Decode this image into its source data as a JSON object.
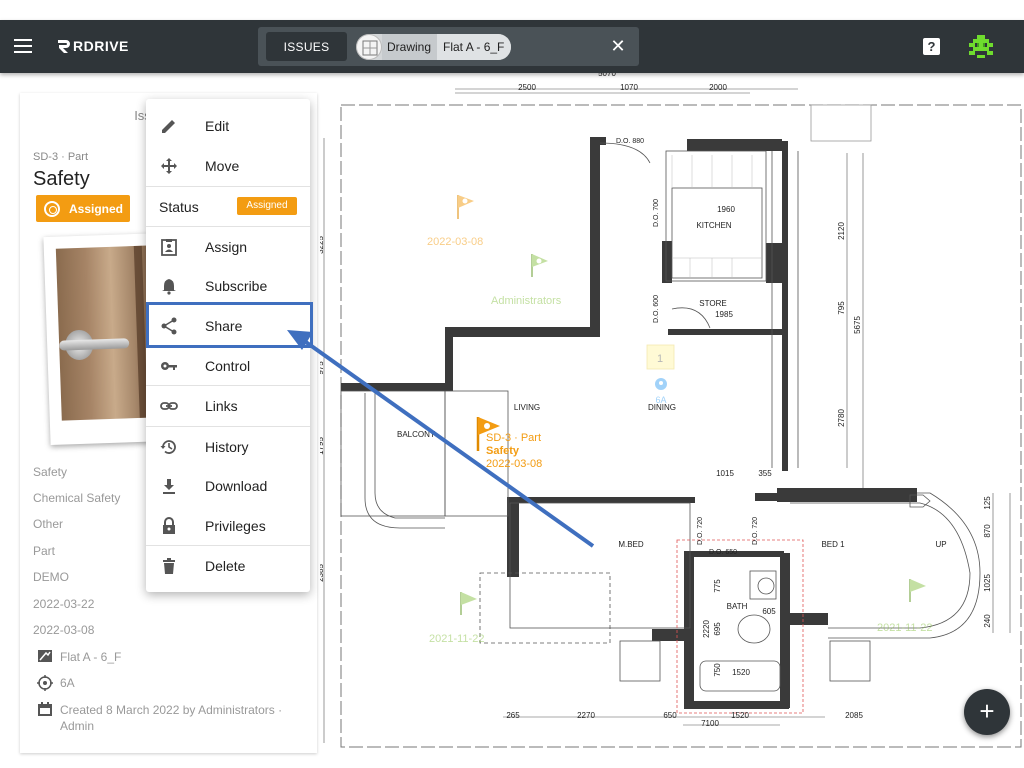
{
  "app": {
    "brand": "RDRIVE"
  },
  "tabs": {
    "issues_label": "ISSUES",
    "chip_type": "Drawing",
    "chip_name": "Flat A - 6_F",
    "close_symbol": "✕"
  },
  "header_icons": {
    "help": "?",
    "avatar": "pixel-avatar"
  },
  "issue": {
    "header": "Issue - 修繕",
    "sub": "SD-3 · Part",
    "title": "Safety",
    "status_badge": "Assigned",
    "fields": [
      "Safety",
      "Chemical Safety",
      "Other",
      "Part",
      "DEMO",
      "2022-03-22",
      "2022-03-08"
    ],
    "drawing": "Flat A - 6_F",
    "location": "6A",
    "created": "Created 8 March 2022 by Administrators · Admin"
  },
  "menu": {
    "items": [
      {
        "label": "Edit",
        "icon": "pencil-icon"
      },
      {
        "label": "Move",
        "icon": "move-icon"
      },
      {
        "label": "Assign",
        "icon": "assign-icon"
      },
      {
        "label": "Subscribe",
        "icon": "bell-icon"
      },
      {
        "label": "Share",
        "icon": "share-icon"
      },
      {
        "label": "Control",
        "icon": "key-icon"
      },
      {
        "label": "Links",
        "icon": "link-icon"
      },
      {
        "label": "History",
        "icon": "history-icon"
      },
      {
        "label": "Download",
        "icon": "download-icon"
      },
      {
        "label": "Privileges",
        "icon": "lock-icon"
      },
      {
        "label": "Delete",
        "icon": "trash-icon"
      }
    ],
    "status_label": "Status",
    "status_value": "Assigned"
  },
  "drawing": {
    "rooms": [
      "KITCHEN",
      "STORE",
      "LIVING",
      "DINING",
      "BALCONY",
      "M.BED",
      "BED 1",
      "BATH",
      "UP"
    ],
    "dims_top": [
      "5070",
      "2500",
      "1070",
      "2000"
    ],
    "dims_bottom": [
      "265",
      "2270",
      "650",
      "1520",
      "2085",
      "7100"
    ],
    "dims_left": [
      "3225",
      "975",
      "1795",
      "2385"
    ],
    "dims_right": [
      "2120",
      "795",
      "5675",
      "2780",
      "125",
      "870",
      "1025",
      "240"
    ],
    "dims_inner": [
      "D.O. 880",
      "1960",
      "1985",
      "D.O. 700",
      "D.O. 600",
      "1015",
      "355",
      "D.O. 720",
      "D.O. 720",
      "D.O. 650",
      "775",
      "605",
      "2220",
      "695",
      "750",
      "1520"
    ],
    "pins": [
      {
        "label": "2022-03-08",
        "color": "#f39c12"
      },
      {
        "label": "Administrators",
        "color": "#8bc34a"
      },
      {
        "label": "2021-11-22",
        "color": "#8bc34a"
      },
      {
        "label": "2021-11-22",
        "color": "#8bc34a"
      }
    ],
    "active_pin": {
      "line1": "SD-3 · Part",
      "line2": "Safety",
      "line3": "2022-03-08"
    },
    "cluster_count": "1",
    "location_tag": "6A"
  },
  "fab_label": "+",
  "colors": {
    "appbar": "#2f3539",
    "accent": "#f39c12",
    "highlight": "#3f6fbf",
    "pin_green": "#8bc34a"
  }
}
